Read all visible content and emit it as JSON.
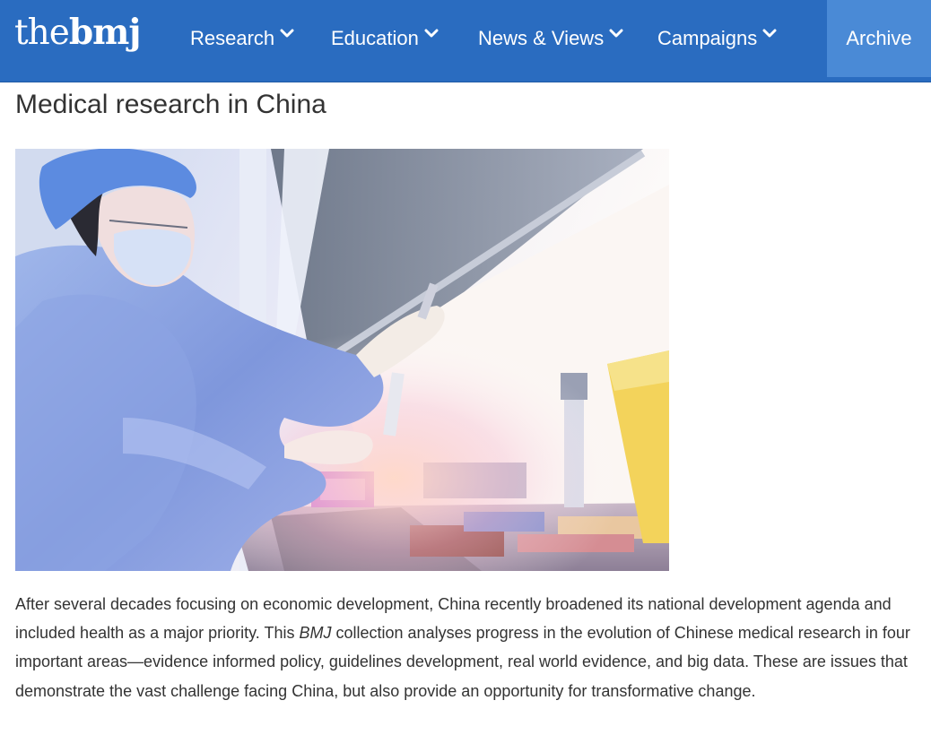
{
  "header": {
    "logo_thin": "the",
    "logo_bold": "bmj",
    "nav_items": [
      {
        "label": "Research"
      },
      {
        "label": "Education"
      },
      {
        "label": "News & Views"
      },
      {
        "label": "Campaigns"
      }
    ],
    "archive_label": "Archive",
    "nav_color": "#2a6cc0",
    "archive_color": "#4a8ad6"
  },
  "page": {
    "title": "Medical research in China"
  },
  "hero_image": {
    "icon": "laboratory-scientist-pipette-photo"
  },
  "intro": {
    "part1": "After several decades focusing on economic development, China recently broadened its national development agenda and included health as a major priority. This ",
    "journal": "BMJ",
    "part2": " collection analyses progress in the evolution of Chinese medical research in four important areas—evidence informed policy, guidelines development, real world evidence, and big data. These are issues that demonstrate the vast challenge facing China, but also provide an opportunity for transformative change."
  }
}
